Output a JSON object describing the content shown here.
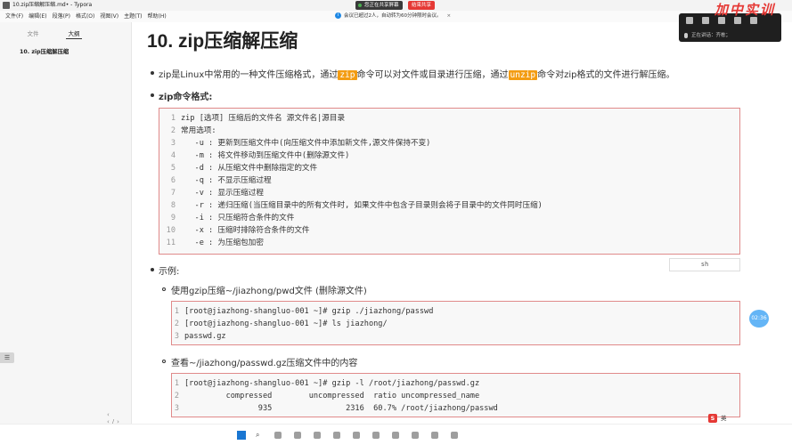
{
  "window": {
    "title": "10.zip压缩解压缩.md• - Typora",
    "share_status": "您正在共享屏幕",
    "share_end": "结束共享"
  },
  "menu": [
    "文件(F)",
    "编辑(E)",
    "段落(P)",
    "格式(O)",
    "视图(V)",
    "主题(T)",
    "帮助(H)"
  ],
  "notice": {
    "text": "会议已超过2人，自动转为60分钟限时会议。",
    "close": "×"
  },
  "sidebar": {
    "tabs": [
      "文件",
      "大纲"
    ],
    "active_tab": "大纲",
    "outline": [
      "10. zip压缩解压缩"
    ],
    "handle": "☰",
    "nav": "‹ ‹/›"
  },
  "meeting": {
    "speaking_label": "正在讲话：",
    "speaker": "齐栋；"
  },
  "watermark": "加中实训",
  "doc": {
    "h1": "10. zip压缩解压缩",
    "intro": {
      "pre": "zip是Linux中常用的一种文件压缩格式，通过",
      "cmd1": "zip",
      "mid": "命令可以对文件或目录进行压缩，通过",
      "cmd2": "unzip",
      "post": "命令对zip格式的文件进行解压缩。"
    },
    "format_heading": "zip命令格式:",
    "format_code": [
      "zip [选项] 压缩后的文件名 源文件名|源目录",
      "常用选项:",
      "   -u : 更新到压缩文件中(向压缩文件中添加新文件,源文件保持不变)",
      "   -m : 将文件移动到压缩文件中(删除源文件)",
      "   -d : 从压缩文件中删除指定的文件",
      "   -q : 不显示压缩过程",
      "   -v : 显示压缩过程",
      "   -r : 递归压缩(当压缩目录中的所有文件时, 如果文件中包含子目录则会将子目录中的文件同时压缩)",
      "   -i : 只压缩符合条件的文件",
      "   -x : 压缩时排除符合条件的文件",
      "   -e : 为压缩包加密"
    ],
    "lang_tag": "sh",
    "example_heading": "示例:",
    "example1_desc": "使用gzip压缩~/jiazhong/pwd文件 (删除源文件)",
    "example1_code": [
      "[root@jiazhong-shangluo-001 ~]# gzip ./jiazhong/passwd",
      "[root@jiazhong-shangluo-001 ~]# ls jiazhong/",
      "passwd.gz"
    ],
    "example2_desc": "查看~/jiazhong/passwd.gz压缩文件中的内容",
    "example2_code": [
      "[root@jiazhong-shangluo-001 ~]# gzip -l /root/jiazhong/passwd.gz",
      "         compressed        uncompressed  ratio uncompressed_name",
      "                935                2316  60.7% /root/jiazhong/passwd"
    ],
    "timer": "02:36"
  },
  "taskbar": {
    "ime": "英",
    "search_icon": "⌕"
  }
}
